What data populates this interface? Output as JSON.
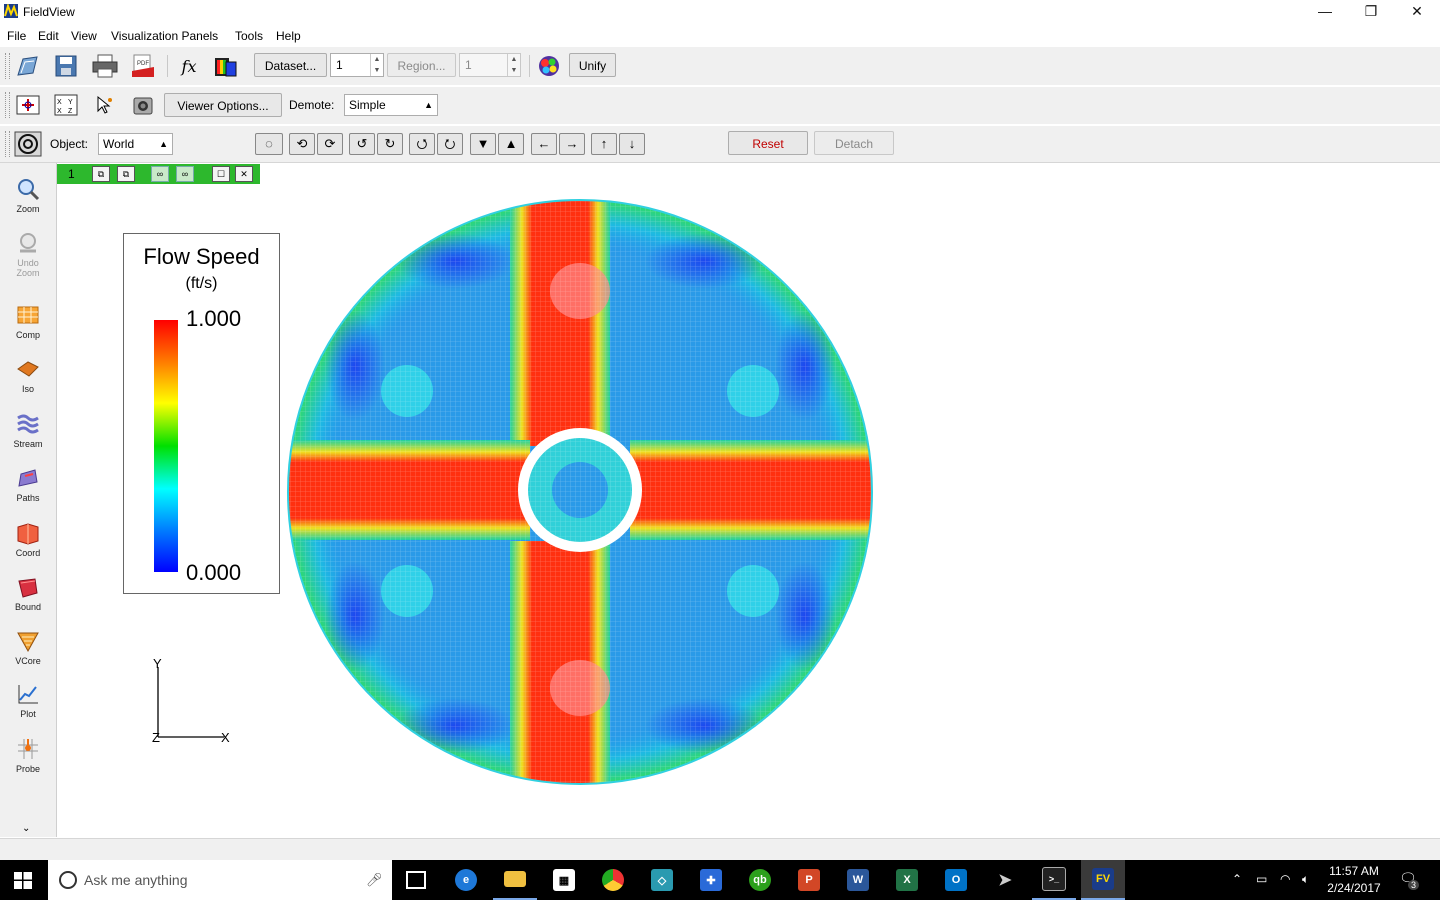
{
  "window": {
    "title": "FieldView",
    "minimize": "—",
    "maximize": "❐",
    "close": "✕"
  },
  "menu": [
    "File",
    "Edit",
    "View",
    "Visualization Panels",
    "Tools",
    "Help"
  ],
  "toolbar1": {
    "dataset_button": "Dataset...",
    "dataset_value": "1",
    "region_button": "Region...",
    "region_value": "1",
    "unify_button": "Unify"
  },
  "toolbar2": {
    "viewer_options_button": "Viewer Options...",
    "demote_label": "Demote:",
    "demote_value": "Simple"
  },
  "toolbar3": {
    "object_label": "Object:",
    "object_value": "World",
    "reset_button": "Reset",
    "detach_button": "Detach"
  },
  "panels": [
    {
      "label": "Zoom",
      "icon": "zoom-icon",
      "enabled": true
    },
    {
      "label": "Undo Zoom",
      "icon": "undo-zoom-icon",
      "enabled": false
    },
    {
      "label": "Comp",
      "icon": "comp-icon",
      "enabled": true
    },
    {
      "label": "Iso",
      "icon": "iso-icon",
      "enabled": true
    },
    {
      "label": "Stream",
      "icon": "stream-icon",
      "enabled": true
    },
    {
      "label": "Paths",
      "icon": "paths-icon",
      "enabled": true
    },
    {
      "label": "Coord",
      "icon": "coord-icon",
      "enabled": true
    },
    {
      "label": "Bound",
      "icon": "bound-icon",
      "enabled": true
    },
    {
      "label": "VCore",
      "icon": "vcore-icon",
      "enabled": true
    },
    {
      "label": "Plot",
      "icon": "plot-icon",
      "enabled": true
    },
    {
      "label": "Probe",
      "icon": "probe-icon",
      "enabled": true
    }
  ],
  "viewport": {
    "tab_number": "1",
    "legend": {
      "title": "Flow Speed",
      "units": "(ft/s)",
      "max": "1.000",
      "min": "0.000"
    },
    "axes": {
      "y": "Y",
      "z": "Z",
      "x": "X"
    }
  },
  "taskbar": {
    "search_placeholder": "Ask me anything",
    "time": "11:57 AM",
    "date": "2/24/2017",
    "notifications": "3"
  },
  "colors": {
    "reset_text": "#c00000",
    "tab_green": "#2db82d",
    "taskbar": "#000000"
  }
}
